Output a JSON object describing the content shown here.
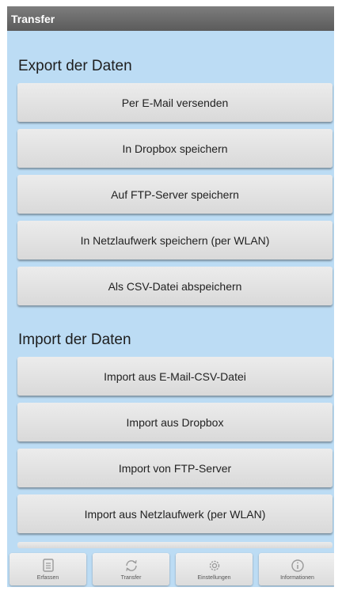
{
  "title": "Transfer",
  "export": {
    "heading": "Export der Daten",
    "buttons": [
      "Per E-Mail versenden",
      "In Dropbox speichern",
      "Auf FTP-Server speichern",
      "In Netzlaufwerk speichern (per WLAN)",
      "Als CSV-Datei abspeichern"
    ]
  },
  "import": {
    "heading": "Import der Daten",
    "buttons": [
      "Import aus E-Mail-CSV-Datei",
      "Import aus Dropbox",
      "Import von FTP-Server",
      "Import aus Netzlaufwerk (per WLAN)"
    ]
  },
  "tabs": [
    {
      "label": "Erfassen",
      "icon": "document-icon"
    },
    {
      "label": "Transfer",
      "icon": "sync-icon"
    },
    {
      "label": "Einstellungen",
      "icon": "gear-icon"
    },
    {
      "label": "Informationen",
      "icon": "info-icon"
    }
  ],
  "colors": {
    "background": "#bcdcf4",
    "titlebar": "#6b6b6b",
    "button": "#e3e3e3"
  }
}
